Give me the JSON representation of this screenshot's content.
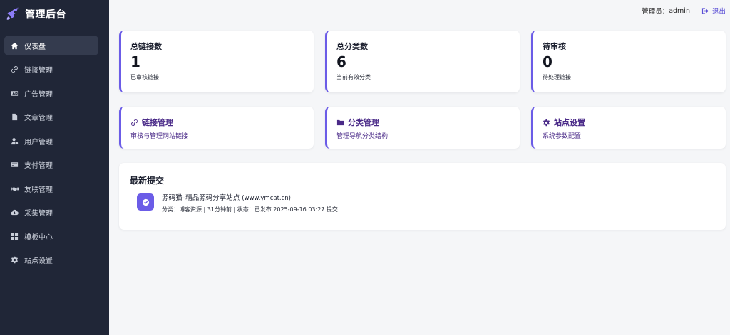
{
  "brand": {
    "title": "管理后台",
    "icon": "rocket-icon"
  },
  "sidebar": {
    "items": [
      {
        "label": "仪表盘",
        "icon": "home-icon",
        "active": true
      },
      {
        "label": "链接管理",
        "icon": "link-icon"
      },
      {
        "label": "广告管理",
        "icon": "ad-icon"
      },
      {
        "label": "文章管理",
        "icon": "file-icon"
      },
      {
        "label": "用户管理",
        "icon": "user-gear-icon"
      },
      {
        "label": "支付管理",
        "icon": "credit-card-icon"
      },
      {
        "label": "友联管理",
        "icon": "handshake-icon"
      },
      {
        "label": "采集管理",
        "icon": "cloud-download-icon"
      },
      {
        "label": "模板中心",
        "icon": "grid-icon"
      },
      {
        "label": "站点设置",
        "icon": "gear-icon"
      }
    ]
  },
  "topbar": {
    "admin_label": "管理员：",
    "admin_name": "admin",
    "logout_label": "退出"
  },
  "stats": [
    {
      "title": "总链接数",
      "value": "1",
      "sub": "已审核链接"
    },
    {
      "title": "总分类数",
      "value": "6",
      "sub": "当前有效分类"
    },
    {
      "title": "待审核",
      "value": "0",
      "sub": "待处理链接"
    }
  ],
  "quick_links": [
    {
      "title": "链接管理",
      "desc": "审核与管理网站链接",
      "icon": "link-icon"
    },
    {
      "title": "分类管理",
      "desc": "管理导航分类结构",
      "icon": "folder-icon"
    },
    {
      "title": "站点设置",
      "desc": "系统参数配置",
      "icon": "gear-icon"
    }
  ],
  "recent": {
    "title": "最新提交",
    "entries": [
      {
        "name": "源码猫–精品源码分享站点",
        "url": "(www.ymcat.cn)",
        "meta": "分类：博客资源 | 31分钟前 | 状态：已发布 2025-09-16 03:27 提交",
        "icon": "check-circle-icon"
      }
    ]
  },
  "colors": {
    "sidebar_bg": "#202637",
    "accent": "#6b5ce7",
    "link_text": "#4a2a88",
    "page_bg": "#f5f6f8"
  }
}
